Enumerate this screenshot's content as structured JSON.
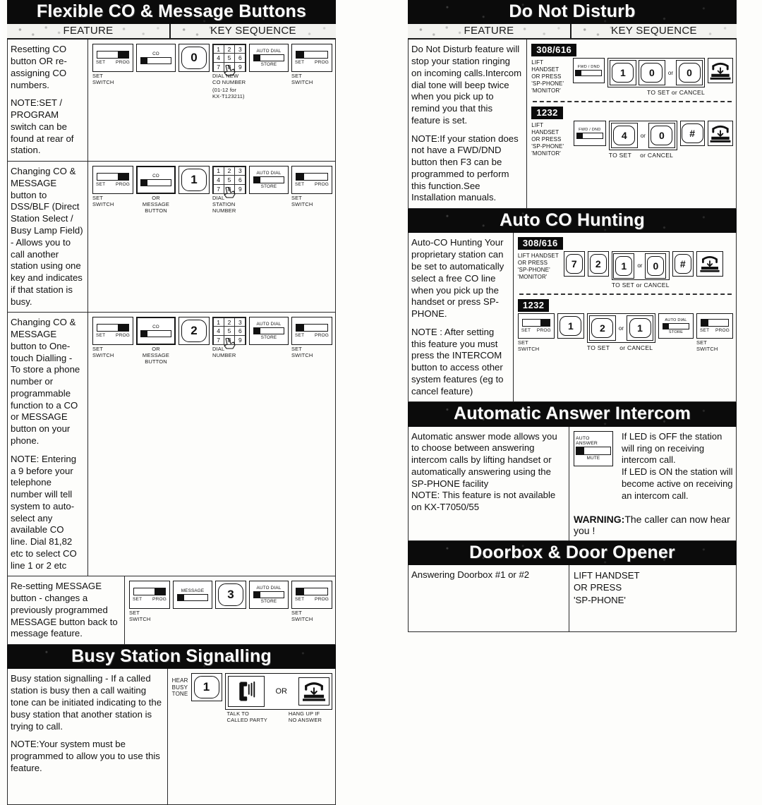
{
  "document": {
    "type": "telephone-system-quick-reference-card",
    "columns": {
      "feature_header": "FEATURE",
      "keyseq_header": "KEY SEQUENCE"
    }
  },
  "labels": {
    "set_switch": "SET\nSWITCH",
    "set": "SET",
    "prog": "PROG",
    "co": "CO",
    "message": "MESSAGE",
    "auto_dial": "AUTO DIAL",
    "store": "STORE",
    "or": "OR",
    "or_lower": "or",
    "fwd_dnd": "FWD / DND",
    "auto_answer": "AUTO ANSWER",
    "mute": "MUTE",
    "hash": "#",
    "lift_handset_block": "LIFT HANDSET\nOR PRESS\n'SP-PHONE'\n'MONITOR'",
    "to_set_or_cancel": "TO SET  or  CANCEL",
    "to_set_or_cancel_tight": "TO SET or CANCEL",
    "to_set": "TO SET",
    "cancel": "or  CANCEL"
  },
  "left_column": {
    "sections": [
      {
        "id": "flexible-co-message-buttons",
        "title": "Flexible CO & Message Buttons",
        "rows": [
          {
            "feature": [
              "Resetting  CO button OR re-assigning CO numbers.",
              "NOTE:SET / PROGRAM switch can be found at rear of station."
            ],
            "keys": {
              "digit": "0",
              "captions": {
                "set_switch": "SET\nSWITCH",
                "dial": "DIAL NEW\nCO NUMBER",
                "dial_note": "(01-12 for\nKX-T123211)",
                "set_switch2": "SET\nSWITCH"
              }
            }
          },
          {
            "feature": [
              "Changing CO & MESSAGE button to DSS/BLF (Direct Station Select / Busy Lamp Field) - Allows you to call another station using one key and indicates if that station is busy."
            ],
            "keys": {
              "digit": "1",
              "captions": {
                "set_switch": "SET\nSWITCH",
                "or_message_button": "OR\nMESSAGE\nBUTTON",
                "dial": "DIAL\nSTATION\nNUMBER",
                "set_switch2": "SET\nSWITCH"
              }
            }
          },
          {
            "feature": [
              "Changing CO & MESSAGE button to One-touch Dialling - To store a phone number or programmable function to a CO or MESSAGE button on your phone.",
              "NOTE: Entering a 9 before your telephone number will tell system to auto-select any available CO line. Dial 81,82 etc to select CO line 1 or 2 etc"
            ],
            "keys": {
              "digit": "2",
              "captions": {
                "set_switch": "SET\nSWITCH",
                "or_message_button": "OR\nMESSAGE\nBUTTON",
                "dial": "DIAL\nNUMBER",
                "set_switch2": "SET\nSWITCH"
              }
            }
          },
          {
            "feature": [
              "Re-setting MESSAGE button - changes a previously programmed MESSAGE button back to message feature."
            ],
            "keys": {
              "digit": "3",
              "captions": {
                "set_switch": "SET\nSWITCH",
                "set_switch2": "SET\nSWITCH"
              }
            }
          }
        ]
      },
      {
        "id": "busy-station-signalling",
        "title": "Busy Station Signalling",
        "rows": [
          {
            "feature": [
              "Busy station signalling - If a called station is busy then a call waiting tone can be initiated indicating to the busy station that another station is trying to call.",
              "NOTE:Your system must be programmed to allow you to use this feature."
            ],
            "keys": {
              "hear_busy_tone": "HEAR\nBUSY\nTONE",
              "digit": "1",
              "or": "OR",
              "talk_caption": "TALK TO\nCALLED PARTY",
              "hangup_caption": "HANG UP IF\nNO ANSWER"
            }
          }
        ]
      }
    ]
  },
  "right_column": {
    "sections": [
      {
        "id": "do-not-disturb",
        "title": "Do Not Disturb",
        "rows": [
          {
            "feature": [
              "Do Not Disturb feature will stop your station ringing on incoming calls.Intercom dial tone will beep twice when you pick up to remind you that this feature is set.",
              "NOTE:If your station does not have a FWD/DND button then F3 can be programmed to perform this function.See Installation manuals."
            ],
            "sequences": [
              {
                "model": "308/616",
                "lift": "LIFT HANDSET\nOR PRESS\n'SP-PHONE'\n'MONITOR'",
                "fwd_dnd": "FWD / DND",
                "keys": [
                  "1",
                  "0"
                ],
                "alt_key": "0",
                "footer": "TO SET  or  CANCEL"
              },
              {
                "model": "1232",
                "lift": "LIFT HANDSET\nOR PRESS\n'SP-PHONE'\n'MONITOR'",
                "fwd_dnd": "FWD / DND",
                "keys": [
                  "4"
                ],
                "alt_key": "0",
                "hash": "#",
                "footer_set": "TO SET",
                "footer_cancel": "or   CANCEL"
              }
            ]
          }
        ]
      },
      {
        "id": "auto-co-hunting",
        "title": "Auto CO Hunting",
        "rows": [
          {
            "feature": [
              "Auto-CO Hunting Your proprietary station can be set to automatically select a free CO line when you pick up the handset or press SP-PHONE.",
              "NOTE : After setting this feature you must press the INTERCOM button to access other system features (eg to cancel feature)"
            ],
            "sequences": [
              {
                "model": "308/616",
                "lift": "LIFT HANDSET\nOR PRESS\n'SP-PHONE'\n'MONITOR'",
                "prefix": [
                  "7",
                  "2"
                ],
                "keys": [
                  "1"
                ],
                "alt_key": "0",
                "hash": "#",
                "footer": "TO SET or CANCEL"
              },
              {
                "model": "1232",
                "set_switch": "SET\nSWITCH",
                "prefix": [
                  "1"
                ],
                "keys": [
                  "2"
                ],
                "alt_key": "1",
                "set_switch2": "SET\nSWITCH",
                "footer_set": "TO SET",
                "footer_cancel": "or  CANCEL"
              }
            ]
          }
        ]
      },
      {
        "id": "automatic-answer-intercom",
        "title": "Automatic Answer Intercom",
        "rows": [
          {
            "feature": [
              "Automatic answer mode allows you to choose between answering intercom calls by lifting handset or automatically answering using the SP-PHONE facility",
              "NOTE: This feature is not available on KX-T7050/55"
            ],
            "button": {
              "top": "AUTO ANSWER",
              "bottom": "MUTE"
            },
            "led_text": [
              "If LED is OFF the station will ring on receiving intercom call.",
              "If LED is ON the station will become active on receiving an intercom call."
            ],
            "warning_label": "WARNING:",
            "warning_text": "The caller can now hear you !"
          }
        ]
      },
      {
        "id": "doorbox-door-opener",
        "title": "Doorbox & Door Opener",
        "rows": [
          {
            "feature": [
              "Answering Doorbox #1 or #2"
            ],
            "plain_keys": "LIFT HANDSET\nOR PRESS\n'SP-PHONE'"
          }
        ]
      }
    ]
  }
}
